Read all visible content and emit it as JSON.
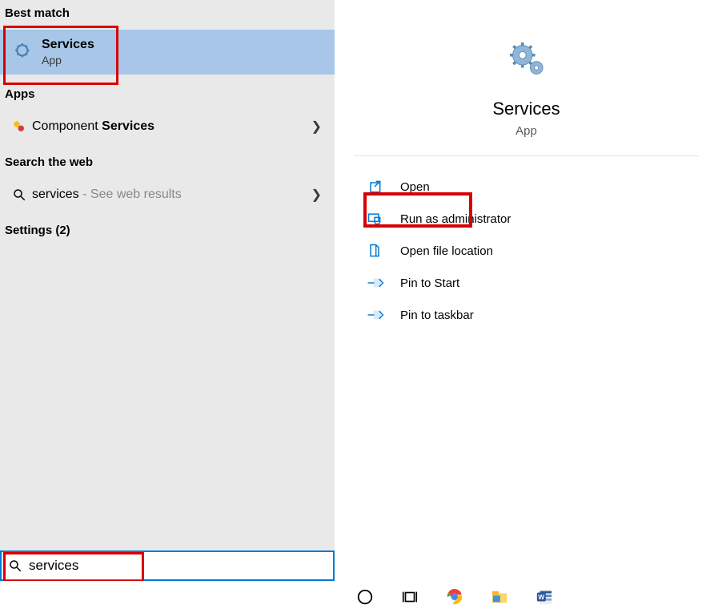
{
  "left": {
    "best_match_header": "Best match",
    "best_match": {
      "title": "Services",
      "subtitle": "App"
    },
    "apps_header": "Apps",
    "apps_item": {
      "prefix": "Component ",
      "bold": "Services"
    },
    "web_header": "Search the web",
    "web_item": {
      "term": "services",
      "hint": " - See web results"
    },
    "settings_header": "Settings (2)"
  },
  "right": {
    "title": "Services",
    "subtitle": "App",
    "actions": {
      "open": "Open",
      "admin": "Run as administrator",
      "location": "Open file location",
      "pin_start": "Pin to Start",
      "pin_taskbar": "Pin to taskbar"
    }
  },
  "search": {
    "value": "services"
  }
}
